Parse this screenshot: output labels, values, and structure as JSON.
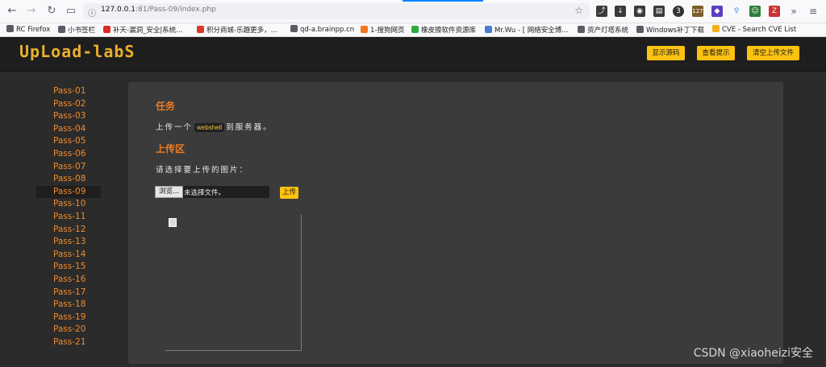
{
  "browser": {
    "url_host": "127.0.0.1",
    "url_path": ":81/Pass-09/index.php",
    "badge_count": "3",
    "badge_count2": "127",
    "bookmarks": [
      {
        "label": "RC Firefox",
        "color": "#5b5b66"
      },
      {
        "label": "小书签栏",
        "color": "#5b5b66"
      },
      {
        "label": "补天-漏洞_安全|系统...",
        "color": "#e02a2a"
      },
      {
        "label": "积分商城-乐趣更多，...",
        "color": "#d9382b"
      },
      {
        "label": "qd-a.brainpp.cn",
        "color": "#5b5b66"
      },
      {
        "label": "1-搜狗网页",
        "color": "#f3761f"
      },
      {
        "label": "橡皮擦软件资源库",
        "color": "#2aae42"
      },
      {
        "label": "Mr.Wu - [ 网络安全博...",
        "color": "#4a7bd0"
      },
      {
        "label": "资产灯塔系统",
        "color": "#5b5b66"
      },
      {
        "label": "Windows补丁下载",
        "color": "#5b5b66"
      },
      {
        "label": "CVE - Search CVE List",
        "color": "#f3b21a"
      }
    ]
  },
  "header": {
    "logo": "UpLoad-labS",
    "buttons": {
      "show_source": "显示源码",
      "show_hint": "查看提示",
      "clear_uploads": "清空上传文件"
    }
  },
  "sidebar": {
    "items": [
      "Pass-01",
      "Pass-02",
      "Pass-03",
      "Pass-04",
      "Pass-05",
      "Pass-06",
      "Pass-07",
      "Pass-08",
      "Pass-09",
      "Pass-10",
      "Pass-11",
      "Pass-12",
      "Pass-13",
      "Pass-14",
      "Pass-15",
      "Pass-16",
      "Pass-17",
      "Pass-18",
      "Pass-19",
      "Pass-20",
      "Pass-21"
    ],
    "active": "Pass-09"
  },
  "main": {
    "task_title": "任务",
    "task_pre": "上传一个",
    "task_code": "webshell",
    "task_post": "到服务器。",
    "upload_title": "上传区",
    "upload_prompt": "请选择要上传的图片：",
    "browse_label": "浏览...",
    "no_file_label": "未选择文件。",
    "upload_button": "上传"
  },
  "watermark": "CSDN @xiaoheizi安全"
}
